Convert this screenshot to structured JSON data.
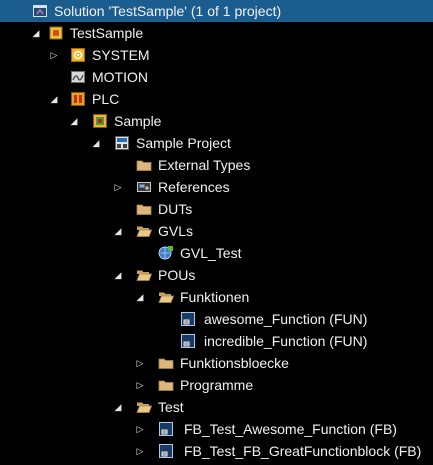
{
  "solution_explorer": {
    "items": [
      {
        "label": "Solution 'TestSample' (1 of 1 project)",
        "icon": "solution-icon",
        "expander": "none",
        "selected": true
      },
      {
        "label": "TestSample",
        "icon": "project-icon",
        "expander": "expanded"
      },
      {
        "label": "SYSTEM",
        "icon": "system-icon",
        "expander": "collapsed"
      },
      {
        "label": "MOTION",
        "icon": "motion-icon",
        "expander": "none"
      },
      {
        "label": "PLC",
        "icon": "plc-icon",
        "expander": "expanded"
      },
      {
        "label": "Sample",
        "icon": "plc-project-icon",
        "expander": "expanded"
      },
      {
        "label": "Sample Project",
        "icon": "plc-instance-icon",
        "expander": "expanded"
      },
      {
        "label": "External Types",
        "icon": "folder-icon",
        "expander": "none"
      },
      {
        "label": "References",
        "icon": "references-icon",
        "expander": "collapsed"
      },
      {
        "label": "DUTs",
        "icon": "folder-icon",
        "expander": "none"
      },
      {
        "label": "GVLs",
        "icon": "folder-open-icon",
        "expander": "expanded"
      },
      {
        "label": "GVL_Test",
        "icon": "gvl-icon",
        "expander": "none"
      },
      {
        "label": "POUs",
        "icon": "folder-open-icon",
        "expander": "expanded"
      },
      {
        "label": "Funktionen",
        "icon": "folder-open-icon",
        "expander": "expanded"
      },
      {
        "label": "awesome_Function (FUN)",
        "icon": "pou-icon",
        "expander": "none"
      },
      {
        "label": "incredible_Function (FUN)",
        "icon": "pou-icon",
        "expander": "none"
      },
      {
        "label": "Funktionsbloecke",
        "icon": "folder-icon",
        "expander": "collapsed"
      },
      {
        "label": "Programme",
        "icon": "folder-icon",
        "expander": "collapsed"
      },
      {
        "label": "Test",
        "icon": "folder-open-icon",
        "expander": "expanded"
      },
      {
        "label": "FB_Test_Awesome_Function (FB)",
        "icon": "pou-icon",
        "expander": "collapsed"
      },
      {
        "label": "FB_Test_FB_GreatFunctionblock (FB)",
        "icon": "pou-icon",
        "expander": "collapsed"
      }
    ]
  },
  "colors": {
    "background": "#000000",
    "selection": "#1b5d8f",
    "text": "#f1f1f1",
    "folder": "#dcb67a"
  }
}
